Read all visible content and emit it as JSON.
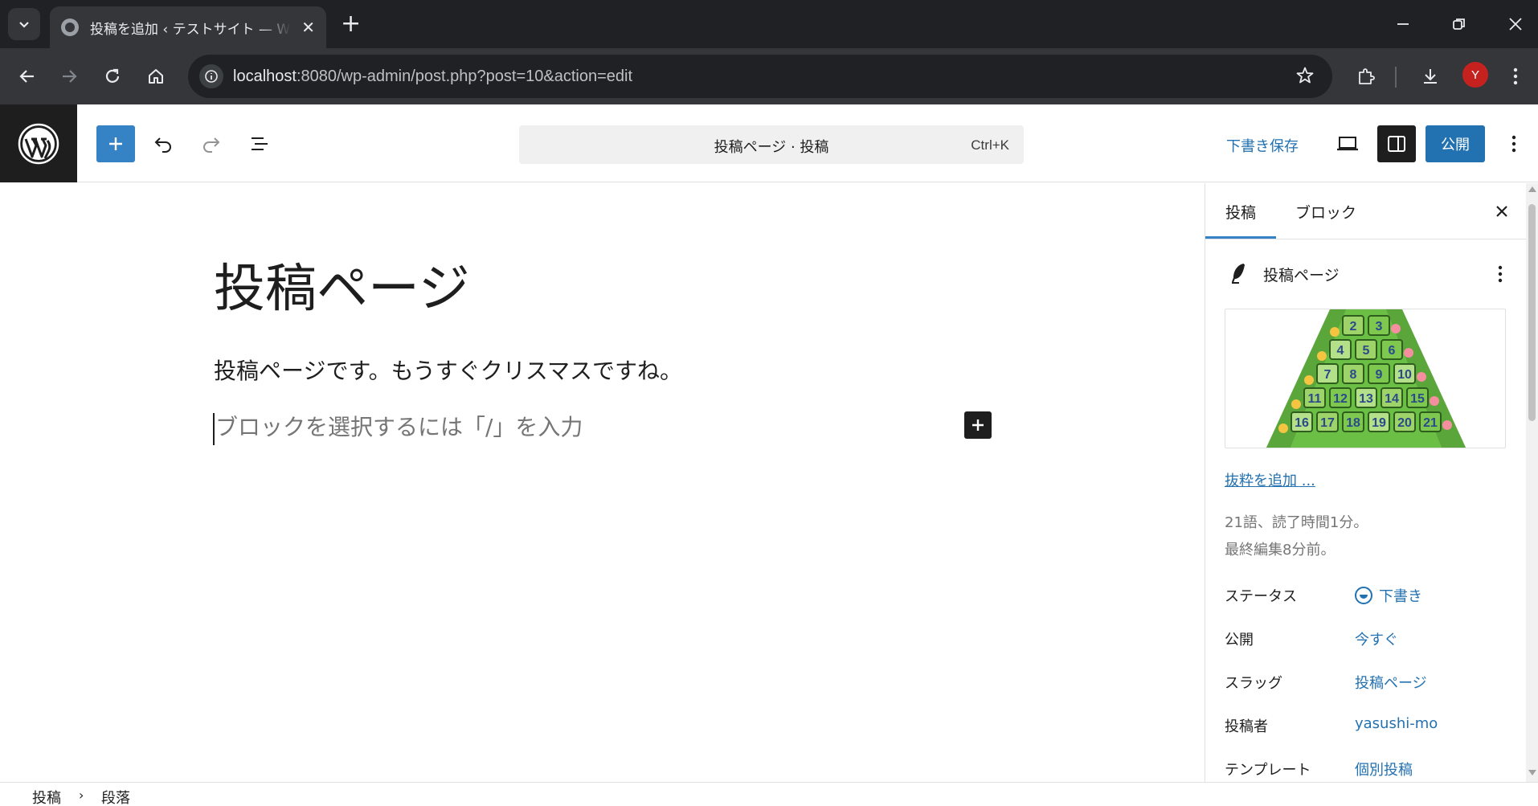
{
  "browser": {
    "tab_title": "投稿を追加 ‹ テストサイト — WordPress",
    "url_host": "localhost",
    "url_rest": ":8080/wp-admin/post.php?post=10&action=edit",
    "profile_initial": "Y"
  },
  "header": {
    "command_title": "投稿ページ · 投稿",
    "command_shortcut": "Ctrl+K",
    "save_draft": "下書き保存",
    "publish": "公開"
  },
  "editor": {
    "title": "投稿ページ",
    "paragraph": "投稿ページです。もうすぐクリスマスですね。",
    "placeholder": "ブロックを選択するには「/」を入力"
  },
  "sidebar": {
    "tab_post": "投稿",
    "tab_block": "ブロック",
    "doc_title": "投稿ページ",
    "add_excerpt": "抜粋を追加 ...",
    "stats_line1": "21語、読了時間1分。",
    "stats_line2": "最終編集8分前。",
    "meta": [
      {
        "label": "ステータス",
        "value": "下書き"
      },
      {
        "label": "公開",
        "value": "今すぐ"
      },
      {
        "label": "スラッグ",
        "value": "投稿ページ"
      },
      {
        "label": "投稿者",
        "value": "yasushi-mo"
      },
      {
        "label": "テンプレート",
        "value": "個別投稿"
      }
    ],
    "featured_image_numbers": [
      "2",
      "3",
      "4",
      "5",
      "6",
      "7",
      "8",
      "9",
      "10",
      "11",
      "12",
      "13",
      "14",
      "15",
      "16",
      "17",
      "18",
      "19",
      "20",
      "21"
    ]
  },
  "footer": {
    "crumb_1": "投稿",
    "crumb_2": "段落"
  },
  "colors": {
    "accent": "#2271b1",
    "dark": "#1e1e1e",
    "chrome_bg": "#202124"
  }
}
